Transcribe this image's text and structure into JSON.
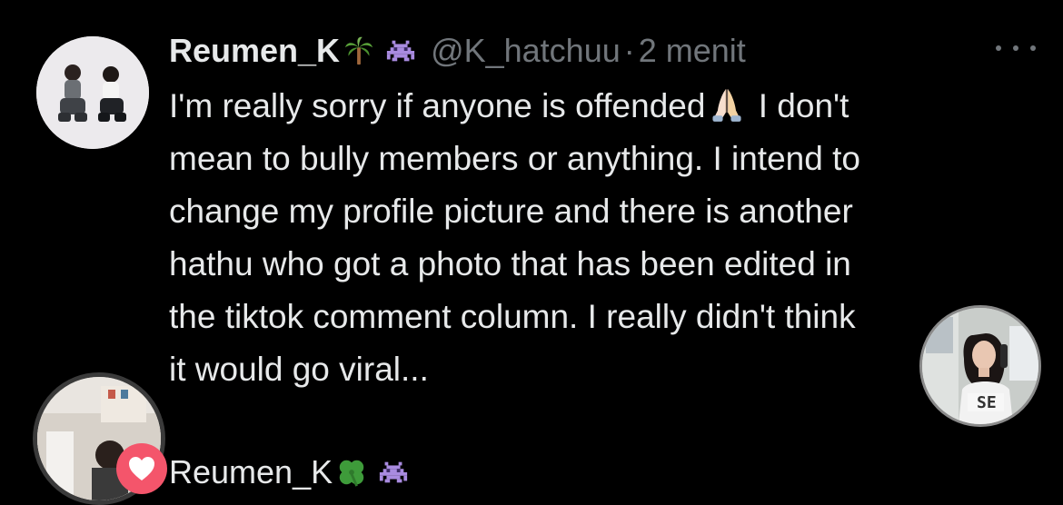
{
  "tweet": {
    "display_name": "Reumen_K",
    "name_emoji_1": "palm-tree-icon",
    "name_emoji_2": "alien-monster-icon",
    "handle": "@K_hatchuu",
    "separator": "·",
    "time": "2 menit",
    "text_part1": "I'm really sorry if anyone is offended",
    "inline_emoji": "folded-hands-icon",
    "text_part2": " I don't\nmean to bully members or anything. I intend to\nchange my profile picture and there is another\nhathu who got a photo that has been edited in\nthe tiktok comment column. I really didn't think\nit would go viral..."
  },
  "next_tweet": {
    "display_name": "Reumen_K",
    "name_emoji_1": "four-leaf-clover-icon",
    "name_emoji_2": "alien-monster-icon"
  },
  "colors": {
    "background": "#000000",
    "primary_text": "#e7e9ea",
    "secondary_text": "#71767b",
    "like": "#f4556b"
  }
}
